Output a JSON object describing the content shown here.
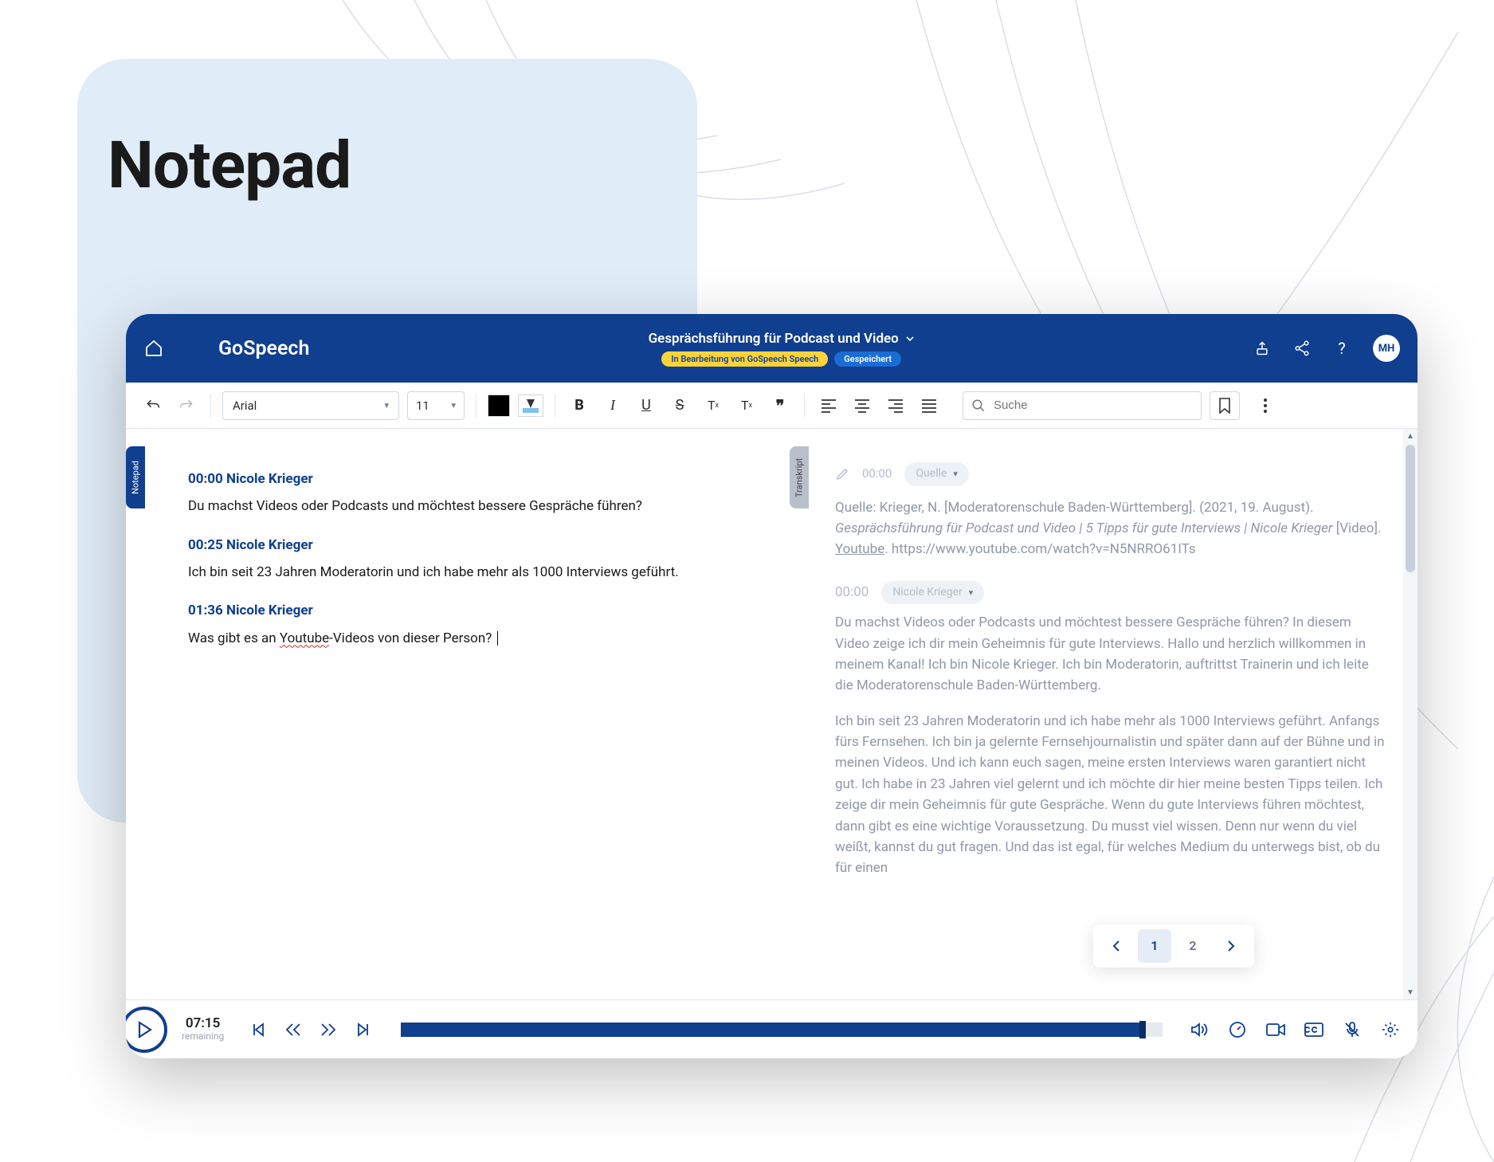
{
  "hero": {
    "title": "Notepad"
  },
  "topbar": {
    "brand": "GoSpeech",
    "doc_title": "Gesprächsführung für Podcast und Video",
    "badge_editing": "In Bearbeitung von GoSpeech Speech",
    "badge_saved": "Gespeichert",
    "help": "?",
    "avatar": "MH"
  },
  "toolbar": {
    "font": "Arial",
    "size": "11",
    "bold": "B",
    "italic": "I",
    "underline": "U",
    "strike": "S",
    "subscript": "T",
    "superscript": "T",
    "quote": "❞",
    "search_placeholder": "Suche"
  },
  "sidetabs": {
    "left": "Notepad",
    "right": "Transkript"
  },
  "notes": [
    {
      "time": "00:00",
      "speaker": "Nicole Krieger",
      "text": "Du machst Videos oder Podcasts und möchtest bessere Gespräche führen?"
    },
    {
      "time": "00:25",
      "speaker": "Nicole Krieger",
      "text": "Ich bin seit 23 Jahren Moderatorin und ich habe mehr als 1000 Interviews geführt."
    },
    {
      "time": "01:36",
      "speaker": "Nicole Krieger",
      "text_pre": "Was gibt es an ",
      "text_err": "Youtube",
      "text_post": "-Videos von dieser Person?"
    }
  ],
  "transcript": {
    "edit_ts": "00:00",
    "source_pill": "Quelle",
    "citation_plain1": "Quelle: Krieger, N. [Moderatorenschule Baden-Württemberg]. (2021, 19. August). ",
    "citation_italic": "Gesprächsführung für Podcast und Video | 5 Tipps für gute Interviews | Nicole Krieger",
    "citation_plain2": " [Video]. ",
    "citation_link": "Youtube",
    "citation_plain3": ". https://www.youtube.com/watch?v=N5NRRO61ITs",
    "seg_ts": "00:00",
    "seg_speaker": "Nicole Krieger",
    "p1": "Du machst Videos oder Podcasts und möchtest bessere Gespräche führen? In diesem Video zeige ich dir mein Geheimnis für gute Interviews. Hallo und herzlich willkommen in meinem Kanal! Ich bin Nicole Krieger. Ich bin Moderatorin, auftrittst Trainerin und ich leite die Moderatorenschule Baden-Württemberg.",
    "p2": "Ich bin seit 23 Jahren Moderatorin und ich habe mehr als 1000 Interviews geführt. Anfangs fürs Fernsehen. Ich bin ja gelernte Fernsehjournalistin und später dann auf der Bühne und in meinen Videos. Und ich kann euch sagen, meine ersten Interviews waren garantiert nicht gut. Ich habe in 23 Jahren viel gelernt und ich möchte dir hier meine besten Tipps teilen. Ich zeige dir mein Geheimnis für gute Gespräche. Wenn du gute Interviews führen möchtest, dann gibt es eine wichtige Voraussetzung. Du musst viel wissen. Denn nur wenn du viel weißt, kannst du gut fragen. Und das ist egal, für welches Medium du unterwegs bist, ob du für einen"
  },
  "pager": {
    "page1": "1",
    "page2": "2"
  },
  "player": {
    "time": "07:15",
    "time_label": "remaining",
    "progress_pct": 97
  }
}
